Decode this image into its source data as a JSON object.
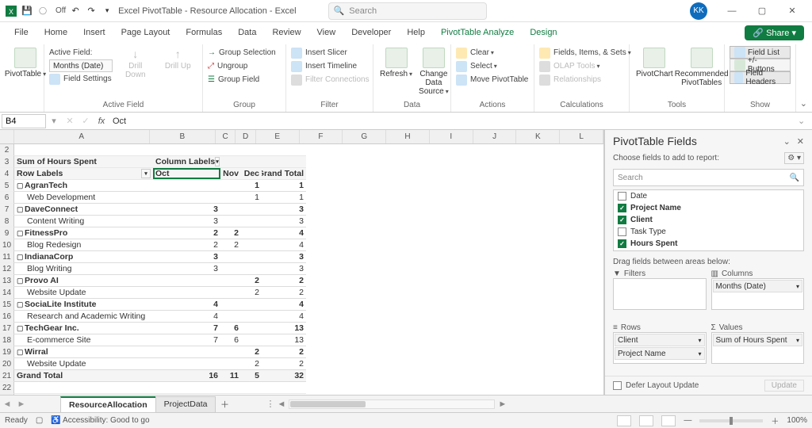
{
  "titlebar": {
    "autosave": "Off",
    "title": "Excel PivotTable - Resource Allocation  -  Excel",
    "search_placeholder": "Search",
    "avatar": "KK"
  },
  "menus": [
    "File",
    "Home",
    "Insert",
    "Page Layout",
    "Formulas",
    "Data",
    "Review",
    "View",
    "Developer",
    "Help",
    "PivotTable Analyze",
    "Design"
  ],
  "share": "Share",
  "ribbon": {
    "pivottable": "PivotTable",
    "active_field": {
      "label": "Active Field:",
      "value": "Months (Date)",
      "settings": "Field Settings",
      "drilldown": "Drill Down",
      "drillup": "Drill Up"
    },
    "group_items": {
      "selection": "Group Selection",
      "ungroup": "Ungroup",
      "field": "Group Field"
    },
    "filter_items": {
      "slicer": "Insert Slicer",
      "timeline": "Insert Timeline",
      "conn": "Filter Connections"
    },
    "data_items": {
      "refresh": "Refresh",
      "source": "Change Data Source"
    },
    "actions_items": {
      "clear": "Clear",
      "select": "Select",
      "move": "Move PivotTable"
    },
    "calc_items": {
      "fis": "Fields, Items, & Sets",
      "olap": "OLAP Tools",
      "rel": "Relationships"
    },
    "tools_items": {
      "chart": "PivotChart",
      "rec": "Recommended PivotTables"
    },
    "show_items": {
      "fl": "Field List",
      "pm": "+/- Buttons",
      "fh": "Field Headers"
    },
    "group_labels": {
      "activefield": "Active Field",
      "group": "Group",
      "filter": "Filter",
      "data": "Data",
      "actions": "Actions",
      "calc": "Calculations",
      "tools": "Tools",
      "show": "Show"
    }
  },
  "fbar": {
    "name": "B4",
    "value": "Oct"
  },
  "columns": [
    "A",
    "B",
    "C",
    "D",
    "E",
    "F",
    "G",
    "H",
    "I",
    "J",
    "K",
    "L"
  ],
  "pivot": {
    "corner_label": "Sum of Hours Spent",
    "col_labels_hdr": "Column Labels",
    "row_labels_hdr": "Row Labels",
    "col_months": [
      "Oct",
      "Nov",
      "Dec"
    ],
    "grand_total": "Grand Total",
    "rows": [
      {
        "r": 5,
        "kind": "grp",
        "a": "AgranTech",
        "d": "1",
        "gt": "1"
      },
      {
        "r": 6,
        "kind": "sub",
        "a": "Web Development",
        "d": "1",
        "gt": "1"
      },
      {
        "r": 7,
        "kind": "grp",
        "a": "DaveConnect",
        "b": "3",
        "gt": "3"
      },
      {
        "r": 8,
        "kind": "sub",
        "a": "Content Writing",
        "b": "3",
        "gt": "3"
      },
      {
        "r": 9,
        "kind": "grp",
        "a": "FitnessPro",
        "b": "2",
        "c": "2",
        "gt": "4"
      },
      {
        "r": 10,
        "kind": "sub",
        "a": "Blog Redesign",
        "b": "2",
        "c": "2",
        "gt": "4"
      },
      {
        "r": 11,
        "kind": "grp",
        "a": "IndianaCorp",
        "b": "3",
        "gt": "3"
      },
      {
        "r": 12,
        "kind": "sub",
        "a": "Blog Writing",
        "b": "3",
        "gt": "3"
      },
      {
        "r": 13,
        "kind": "grp",
        "a": "Provo AI",
        "d": "2",
        "gt": "2"
      },
      {
        "r": 14,
        "kind": "sub",
        "a": "Website Update",
        "d": "2",
        "gt": "2"
      },
      {
        "r": 15,
        "kind": "grp",
        "a": "SociaLite Institute",
        "b": "4",
        "gt": "4"
      },
      {
        "r": 16,
        "kind": "sub",
        "a": "Research and Academic Writing",
        "b": "4",
        "gt": "4"
      },
      {
        "r": 17,
        "kind": "grp",
        "a": "TechGear Inc.",
        "b": "7",
        "c": "6",
        "gt": "13"
      },
      {
        "r": 18,
        "kind": "sub",
        "a": "E-commerce Site",
        "b": "7",
        "c": "6",
        "gt": "13"
      },
      {
        "r": 19,
        "kind": "grp",
        "a": "Wirral",
        "d": "2",
        "gt": "2"
      },
      {
        "r": 20,
        "kind": "sub",
        "a": "Website Update",
        "d": "2",
        "gt": "2"
      },
      {
        "r": 21,
        "kind": "tot",
        "a": "Grand Total",
        "b": "16",
        "c": "11",
        "d": "5",
        "gt": "32"
      }
    ]
  },
  "fieldspane": {
    "title": "PivotTable Fields",
    "sub": "Choose fields to add to report:",
    "search": "Search",
    "fields": [
      {
        "name": "Date",
        "c": false
      },
      {
        "name": "Project Name",
        "c": true
      },
      {
        "name": "Client",
        "c": true
      },
      {
        "name": "Task Type",
        "c": false
      },
      {
        "name": "Hours Spent",
        "c": true
      }
    ],
    "drag_lbl": "Drag fields between areas below:",
    "filters_lbl": "Filters",
    "columns_lbl": "Columns",
    "rows_lbl": "Rows",
    "values_lbl": "Values",
    "col_pill": "Months (Date)",
    "row_pills": [
      "Client",
      "Project Name"
    ],
    "val_pill": "Sum of Hours Spent",
    "defer": "Defer Layout Update",
    "update": "Update"
  },
  "tabs": [
    "ResourceAllocation",
    "ProjectData"
  ],
  "status": {
    "ready": "Ready",
    "acc": "Accessibility: Good to go",
    "zoom": "100%"
  }
}
